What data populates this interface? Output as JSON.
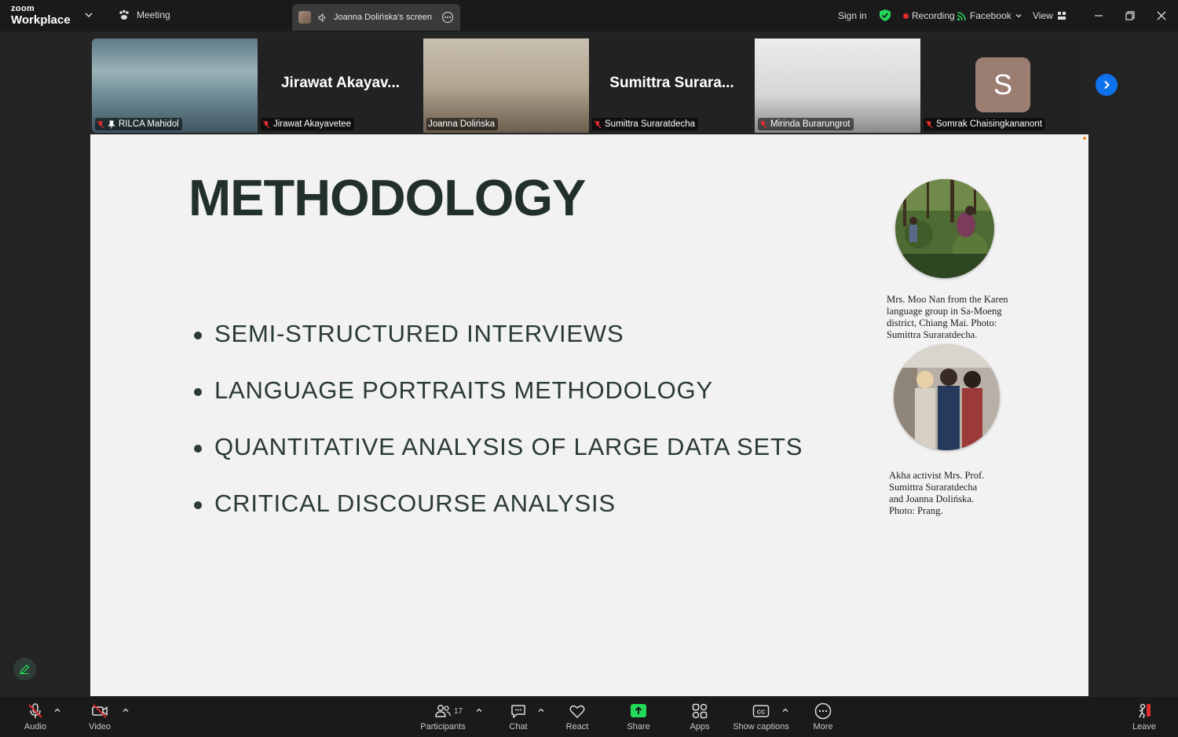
{
  "app": {
    "logo_top": "zoom",
    "logo_bottom": "Workplace"
  },
  "topbar": {
    "meeting_label": "Meeting",
    "screen_tab_label": "Joanna Dolińska's screen",
    "sign_in": "Sign in",
    "recording": "Recording",
    "facebook": "Facebook",
    "view": "View"
  },
  "participants_strip": [
    {
      "name": "RILCA Mahidol",
      "video": true,
      "active": true
    },
    {
      "name": "Jirawat Akayavetee",
      "display_name": "Jirawat  Akayav...",
      "video": false
    },
    {
      "name": "Joanna Dolińska",
      "video": true
    },
    {
      "name": "Sumittra Suraratdecha",
      "display_name": "Sumittra  Surara...",
      "video": false
    },
    {
      "name": "Mirinda Burarungrot",
      "video": true
    },
    {
      "name": "Somrak Chaisingkananont",
      "avatar_letter": "S",
      "video": false
    }
  ],
  "slide": {
    "title": "METHODOLOGY",
    "bullets": [
      "SEMI-STRUCTURED INTERVIEWS",
      "LANGUAGE PORTRAITS METHODOLOGY",
      "QUANTITATIVE ANALYSIS OF LARGE DATA SETS",
      "CRITICAL DISCOURSE ANALYSIS"
    ],
    "caption1": [
      "Mrs. Moo Nan from the Karen",
      "language group in  Sa-Moeng",
      "district, Chiang Mai. Photo:",
      "Sumittra Suraratdecha."
    ],
    "caption2": [
      "Akha activist Mrs. Prof.",
      "Sumittra Suraratdecha",
      "and Joanna Dolińska.",
      "Photo: Prang."
    ]
  },
  "toolbar": {
    "audio": "Audio",
    "video": "Video",
    "participants": "Participants",
    "participants_count": "17",
    "chat": "Chat",
    "react": "React",
    "share": "Share",
    "apps": "Apps",
    "captions": "Show captions",
    "more": "More",
    "leave": "Leave"
  },
  "colors": {
    "accent_blue": "#0e72ed",
    "share_green": "#23d959",
    "record_red": "#e02c2c",
    "active_border": "#2ecc71"
  }
}
